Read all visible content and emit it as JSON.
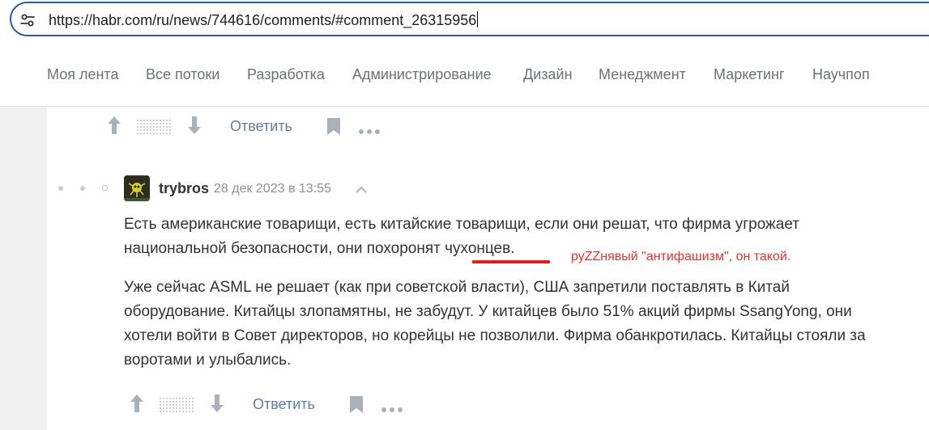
{
  "browser": {
    "url": "https://habr.com/ru/news/744616/comments/#comment_26315956",
    "site_info_icon": "tune-icon"
  },
  "nav": {
    "items": [
      "Моя лента",
      "Все потоки",
      "Разработка",
      "Администрирование",
      "Дизайн",
      "Менеджмент",
      "Маркетинг",
      "Научпоп"
    ]
  },
  "top_actions": {
    "reply_label": "Ответить"
  },
  "comment": {
    "username": "trybros",
    "date": "28 дек 2023 в 13:55",
    "paragraph1_before": "Есть американские товарищи, есть китайские товарищи, если они решат, что фирма угрожает национальной безопасности, они похоронят ",
    "paragraph1_highlight": "чухонцев.",
    "paragraph2": "Уже сейчас ASML не решает (как при советской власти), США запретили поставлять в Китай оборудование. Китайцы злопамятны, не забудут. У китайцев было 51% акций фирмы SsangYong, они хотели войти в Совет директоров, но корейцы не позволили. Фирма обанкротилась. Китайцы стояли за воротами и улыбались.",
    "reply_label": "Ответить"
  },
  "annotation": {
    "text": "руZZнявый \"антифашизм\", он такой.",
    "color": "#e0342c"
  },
  "colors": {
    "accent": "#2d5aa6",
    "link": "#5e7f9d",
    "muted": "#8a9096"
  }
}
